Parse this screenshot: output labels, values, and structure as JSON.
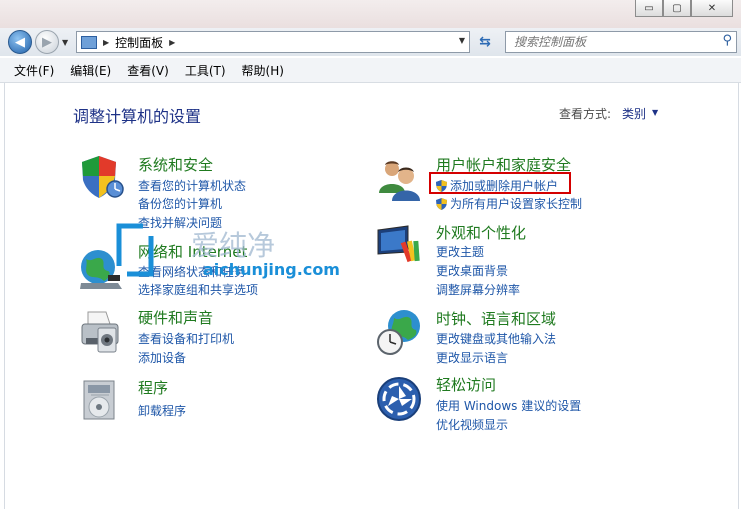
{
  "window": {
    "minimize_label": "▭",
    "maximize_label": "▢",
    "close_label": "✕"
  },
  "address_bar": {
    "path": "控制面板",
    "search_placeholder": "搜索控制面板"
  },
  "menu": [
    "文件(F)",
    "编辑(E)",
    "查看(V)",
    "工具(T)",
    "帮助(H)"
  ],
  "main": {
    "title": "调整计算机的设置",
    "view_by_label": "查看方式:",
    "view_by_value": "类别"
  },
  "categories": [
    {
      "title": "系统和安全",
      "links": [
        "查看您的计算机状态",
        "备份您的计算机",
        "查找并解决问题"
      ],
      "icon": "shield-icon"
    },
    {
      "title": "网络和 Internet",
      "links": [
        "查看网络状态和任务",
        "选择家庭组和共享选项"
      ],
      "icon": "network-icon"
    },
    {
      "title": "硬件和声音",
      "links": [
        "查看设备和打印机",
        "添加设备"
      ],
      "icon": "printer-icon"
    },
    {
      "title": "程序",
      "links": [
        "卸载程序"
      ],
      "icon": "programs-icon"
    },
    {
      "title": "用户帐户和家庭安全",
      "links": [
        "添加或删除用户帐户",
        "为所有用户设置家长控制"
      ],
      "icon": "users-icon"
    },
    {
      "title": "外观和个性化",
      "links": [
        "更改主题",
        "更改桌面背景",
        "调整屏幕分辨率"
      ],
      "icon": "display-icon"
    },
    {
      "title": "时钟、语言和区域",
      "links": [
        "更改键盘或其他输入法",
        "更改显示语言"
      ],
      "icon": "clock-globe-icon"
    },
    {
      "title": "轻松访问",
      "links": [
        "使用 Windows 建议的设置",
        "优化视频显示"
      ],
      "icon": "ease-of-access-icon"
    }
  ],
  "watermark": {
    "brand": "爱纯净",
    "url": "aichunjing.com"
  },
  "colors": {
    "accent": "#1f57a8",
    "category_title": "#1f7a1f",
    "highlight_box": "#d40000"
  }
}
